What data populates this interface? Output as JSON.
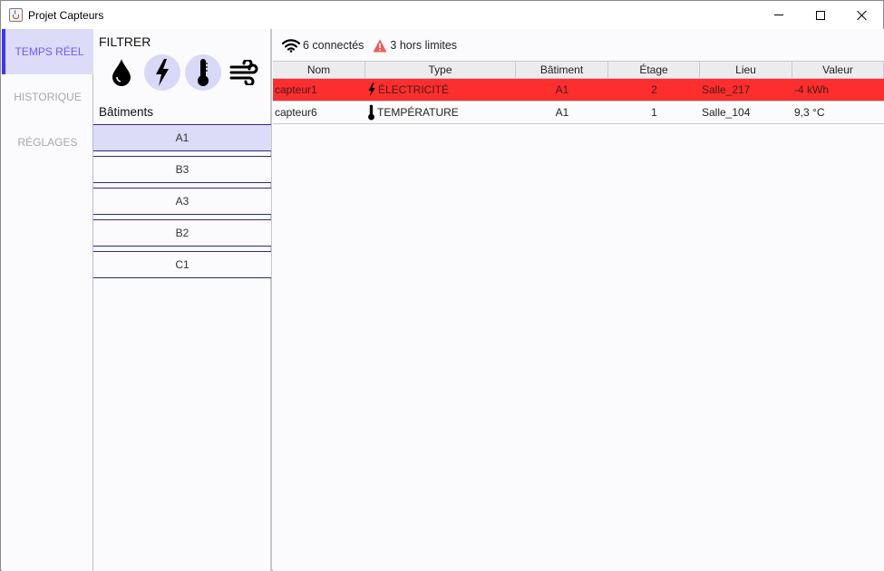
{
  "window": {
    "title": "Projet Capteurs"
  },
  "nav": {
    "items": [
      "TEMPS RÉEL",
      "HISTORIQUE",
      "RÉGLAGES"
    ],
    "active": "TEMPS RÉEL"
  },
  "filters": {
    "title": "FILTRER",
    "type_icons": [
      {
        "name": "water-drop-icon",
        "selected": false
      },
      {
        "name": "lightning-icon",
        "selected": true
      },
      {
        "name": "thermometer-icon",
        "selected": true
      },
      {
        "name": "wind-icon",
        "selected": false
      }
    ],
    "buildings_title": "Bâtiments",
    "buildings": [
      "A1",
      "B3",
      "A3",
      "B2",
      "C1"
    ],
    "selected_building": "A1"
  },
  "status": {
    "connected": "6 connectés",
    "out_of_limits": "3 hors limites"
  },
  "table": {
    "headers": [
      "Nom",
      "Type",
      "Bâtiment",
      "Étage",
      "Lieu",
      "Valeur"
    ],
    "rows": [
      {
        "nom": "capteur1",
        "type": "ÉLECTRICITÉ",
        "type_icon": "lightning-icon",
        "batiment": "A1",
        "etage": "2",
        "lieu": "Salle_217",
        "valeur": "-4 kWh",
        "alert": true
      },
      {
        "nom": "capteur6",
        "type": "TEMPÉRATURE",
        "type_icon": "thermometer-icon",
        "batiment": "A1",
        "etage": "1",
        "lieu": "Salle_104",
        "valeur": "9,3 °C",
        "alert": false
      }
    ]
  },
  "colors": {
    "accent": "#3f33ff",
    "selection": "#dcdcf8",
    "alert_row": "#fd2e2e",
    "warning": "#f05a5a"
  }
}
